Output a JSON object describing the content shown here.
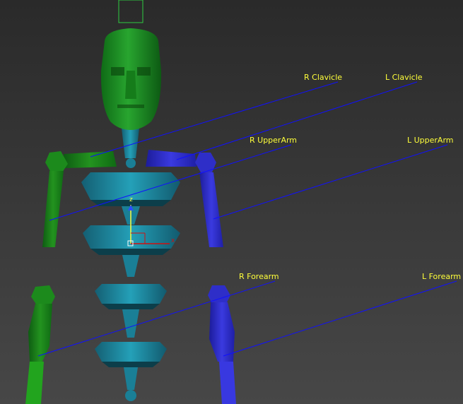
{
  "labels": {
    "r_clavicle": "R Clavicle",
    "l_clavicle": "L Clavicle",
    "r_upperarm": "R UpperArm",
    "l_upperarm": "L UpperArm",
    "r_forearm": "R Forearm",
    "l_forearm": "L Forearm"
  },
  "gizmo": {
    "z_axis": "z",
    "x_axis": "x"
  },
  "colors": {
    "right_side": "#1f8a1f",
    "left_side": "#2e2ec8",
    "spine": "#1a7f96",
    "label_text": "#ffff3a",
    "leader_line": "#1010ff",
    "selection_box": "#2ecc40"
  }
}
